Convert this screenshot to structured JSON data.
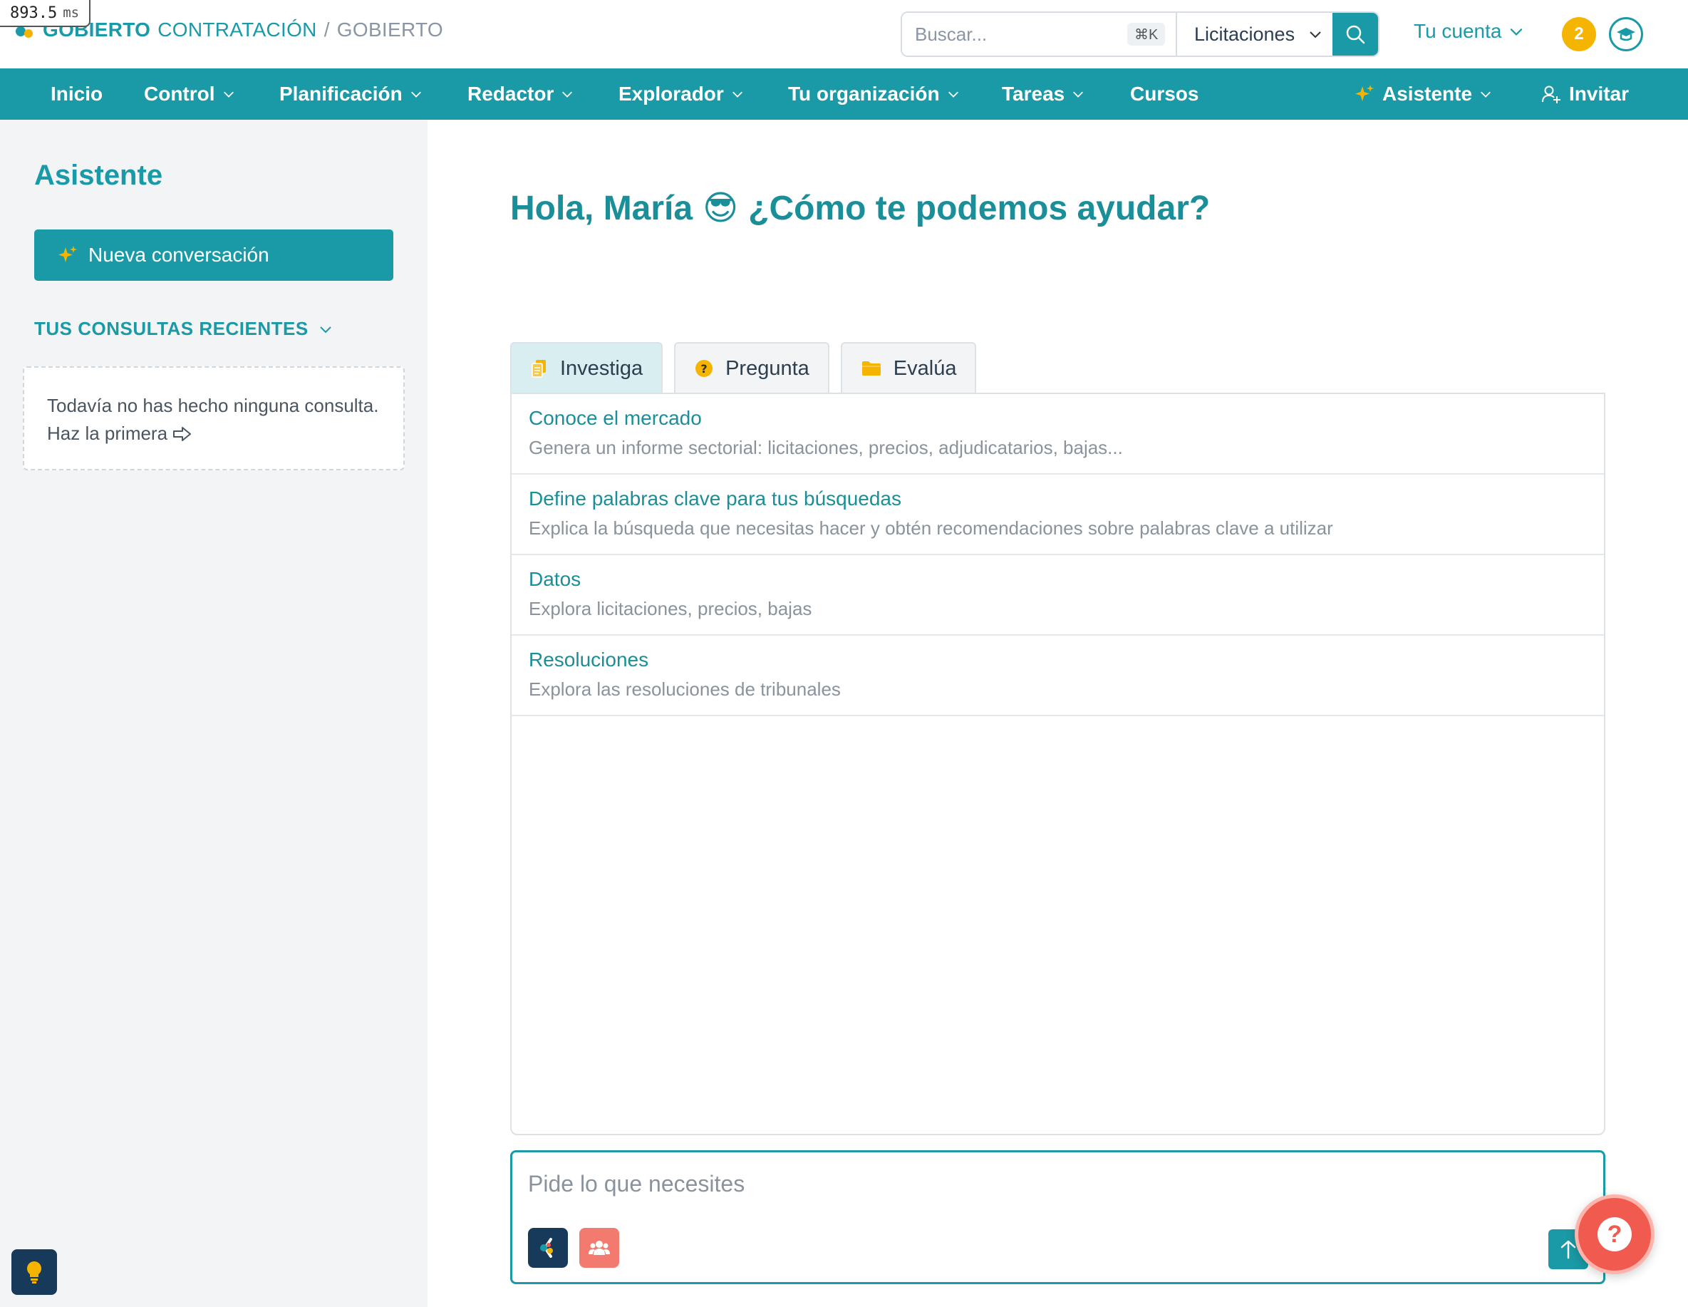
{
  "timing": {
    "value": "893.5",
    "unit": "ms"
  },
  "brand": {
    "name_bold": "GOBIERTO",
    "name_light": "CONTRATACIÓN",
    "separator": "/",
    "org": "GOBIERTO"
  },
  "search": {
    "placeholder": "Buscar...",
    "shortcut": "⌘K",
    "scope": "Licitaciones"
  },
  "account": {
    "label": "Tu cuenta",
    "notifications": "2"
  },
  "nav": {
    "items": [
      {
        "label": "Inicio"
      },
      {
        "label": "Control"
      },
      {
        "label": "Planificación"
      },
      {
        "label": "Redactor"
      },
      {
        "label": "Explorador"
      },
      {
        "label": "Tu organización"
      },
      {
        "label": "Tareas"
      },
      {
        "label": "Cursos"
      }
    ],
    "assistant": "Asistente",
    "invite": "Invitar"
  },
  "sidebar": {
    "title": "Asistente",
    "new_conversation": "Nueva conversación",
    "recent_heading": "TUS CONSULTAS RECIENTES",
    "empty_text": "Todavía no has hecho ninguna consulta. Haz la primera"
  },
  "main": {
    "greeting_name": "Hola, María",
    "greeting_emoji": "😎",
    "greeting_question": "¿Cómo te podemos ayudar?",
    "tabs": [
      {
        "label": "Investiga"
      },
      {
        "label": "Pregunta"
      },
      {
        "label": "Evalúa"
      }
    ],
    "options": [
      {
        "title": "Conoce el mercado",
        "desc": "Genera un informe sectorial: licitaciones, precios, adjudicatarios, bajas..."
      },
      {
        "title": "Define palabras clave para tus búsquedas",
        "desc": "Explica la búsqueda que necesitas hacer y obtén recomendaciones sobre palabras clave a utilizar"
      },
      {
        "title": "Datos",
        "desc": "Explora licitaciones, precios, bajas"
      },
      {
        "title": "Resoluciones",
        "desc": "Explora las resoluciones de tribunales"
      }
    ],
    "composer_placeholder": "Pide lo que necesites",
    "help": "?"
  },
  "colors": {
    "accent": "#1a9aa6",
    "warning": "#f4b400",
    "help": "#f05a4f",
    "sidebar_bg": "#f3f4f6"
  }
}
